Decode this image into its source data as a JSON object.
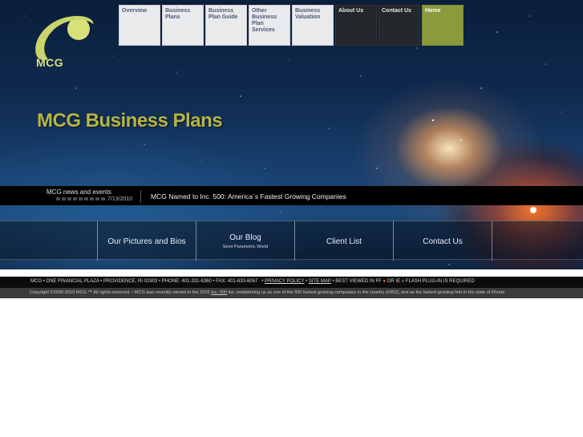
{
  "brand": {
    "logo_text": "MCG"
  },
  "nav": [
    {
      "label": "Overview"
    },
    {
      "label": "Business Plans"
    },
    {
      "label": "Business Plan Guide"
    },
    {
      "label": "Other Business Plan Services"
    },
    {
      "label": "Business Valuation"
    },
    {
      "label": "About Us"
    },
    {
      "label": "Contact Us"
    },
    {
      "label": "Home"
    }
  ],
  "hero": {
    "title": "MCG Business Plans"
  },
  "news": {
    "label": "MCG news and events",
    "date": "7/13/2010",
    "headline": "MCG Named to Inc. 500: America`s Fastest Growing Companies"
  },
  "links": [
    {
      "label": "Our Pictures and Bios",
      "sub": ""
    },
    {
      "label": "Our Blog",
      "sub": "Semi-Parametric World"
    },
    {
      "label": "Client List",
      "sub": ""
    },
    {
      "label": "Contact Us",
      "sub": ""
    }
  ],
  "footer": {
    "address": "MCG • ONE FINANCIAL PLAZA • PROVIDENCE, RI 02903 • PHONE: 401-331-6360 • FAX: 401-633-6067",
    "privacy": "PRIVACY POLICY",
    "sitemap": "SITE MAP",
    "best_viewed": "BEST VIEWED IN FF",
    "or_ie": "OR IE",
    "flash": "FLASH PLUG-IN IS REQUIRED",
    "copyright_pre": "Copyright ©2006-2010 MCG ™ All rights reserved. • MCG was recently named to the 2010",
    "inc_link": "Inc. 500",
    "copyright_post": "list, establishing us as one of the 500 fastest growing companies in the country (#352), and as the fastest growing firm in the state of Rhode"
  },
  "colors": {
    "title": "#b7b443",
    "home_tab": "#8a9a3c",
    "logo": "#d8e07a"
  },
  "icons": {
    "firefox": "firefox-icon",
    "ie": "ie-icon"
  }
}
